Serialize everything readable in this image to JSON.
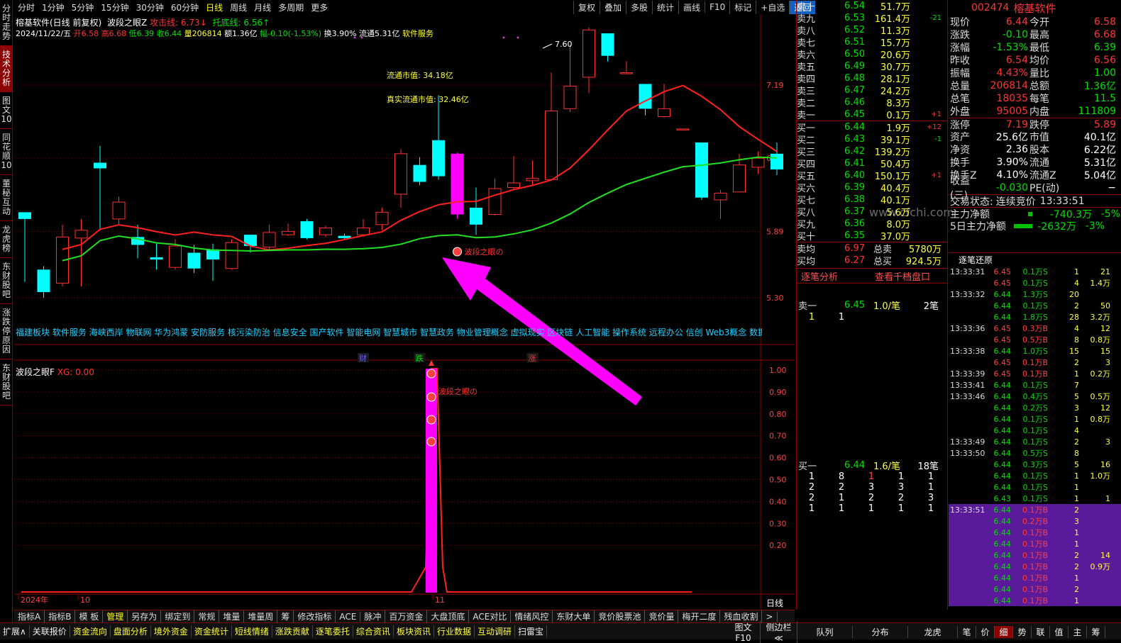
{
  "leftbar": [
    "分时走势",
    "技术分析",
    "图文10",
    "同花顺10",
    "董秘互动",
    "龙虎榜",
    "东财股吧",
    "涨跌停原因",
    "东财股吧"
  ],
  "topbar": {
    "tabs": [
      "分时",
      "1分钟",
      "5分钟",
      "15分钟",
      "30分钟",
      "60分钟",
      "日线",
      "周线",
      "月线",
      "多周期",
      "更多"
    ],
    "active": "日线",
    "right": [
      "复权",
      "叠加",
      "多股",
      "统计",
      "画线",
      "F10",
      "标记",
      "+自选",
      "返回"
    ]
  },
  "title": {
    "name": "榕基软件(日线 前复权)",
    "ind": "波段之眼Z",
    "atk": "攻击线: 6.73↓",
    "sup": "托底线: 6.56↑"
  },
  "ohlc": {
    "date": "2024/11/22/五",
    "open": "开6.58",
    "high": "高6.68",
    "low": "低6.39",
    "close": "收6.44",
    "vol": "量206814",
    "amt": "额1.36亿",
    "chg": "幅-0.10(-1.53%)",
    "turn": "换3.90%",
    "flow": "流通5.31亿",
    "ind": "软件服务"
  },
  "annot": {
    "ltsz": "流通市值: 34.18亿",
    "zsltsz": "真实流通市值: 32.46亿",
    "high": "7.60",
    "signal": "波段之眼の",
    "watermark": "www.cfchi.com"
  },
  "yaxis": [
    "7.19",
    "6.54",
    "5.89",
    "5.30"
  ],
  "yaxis2": [
    "1.00",
    "0.90",
    "0.80",
    "0.70",
    "0.60",
    "0.50",
    "0.40",
    "0.30",
    "0.20"
  ],
  "concepts": "福建板块 软件服务 海峡西岸 物联网 华为鸿蒙 安防服务 核污染防治 信息安全 国产软件 智能电网 智慧城市 智慧政务 物业管理概念 虚拟现实 区块链 人工智能 操作系统 远程办公 信创 Web3概念 数据要素",
  "marks": {
    "cai": "财",
    "die": "跌",
    "zhang": "涨"
  },
  "xaxis": {
    "year": "2024年",
    "m10": "10",
    "m11": "11"
  },
  "sub": {
    "name": "波段之眼F",
    "xg": "XG: 0.00",
    "signal": "波段之眼の"
  },
  "period": "日线",
  "bottom1": [
    "指标A",
    "指标B",
    "模 板",
    "管理",
    "另存为",
    "绑定到",
    "常规",
    "堆量",
    "堆量周",
    "筹",
    "修改指标",
    "ACE",
    "脉冲",
    "百万资金",
    "大盘顶底",
    "ACE对比",
    "情绪风控",
    "东财大单",
    "竞价股票池",
    "竞价量",
    "梅开二度",
    "残血收割",
    ">"
  ],
  "bottom2": [
    "扩展∧",
    "关联报价",
    "资金流向",
    "盘面分析",
    "境外资金",
    "资金统计",
    "短线情绪",
    "涨跌贡献",
    "逐笔委托",
    "综合资讯",
    "板块资讯",
    "行业数据",
    "互动调研",
    "扫雷宝"
  ],
  "bottom2r": [
    "图文F10",
    "侧边栏≪",
    "队列",
    "分布",
    "龙虎",
    "笔",
    "价",
    "细",
    "势",
    "联",
    "值",
    "主",
    "筹"
  ],
  "sells": [
    [
      "卖十",
      "6.54",
      "51.7万",
      ""
    ],
    [
      "卖九",
      "6.53",
      "161.4万",
      "-21"
    ],
    [
      "卖八",
      "6.52",
      "11.3万",
      ""
    ],
    [
      "卖七",
      "6.51",
      "15.7万",
      ""
    ],
    [
      "卖六",
      "6.50",
      "20.6万",
      ""
    ],
    [
      "卖五",
      "6.49",
      "30.7万",
      ""
    ],
    [
      "卖四",
      "6.48",
      "28.1万",
      ""
    ],
    [
      "卖三",
      "6.47",
      "24.2万",
      ""
    ],
    [
      "卖二",
      "6.46",
      "8.3万",
      ""
    ],
    [
      "卖一",
      "6.45",
      "0.1万",
      "+1"
    ]
  ],
  "buys": [
    [
      "买一",
      "6.44",
      "1.9万",
      "+12"
    ],
    [
      "买二",
      "6.43",
      "39.1万",
      "-1"
    ],
    [
      "买三",
      "6.42",
      "139.2万",
      ""
    ],
    [
      "买四",
      "6.41",
      "50.4万",
      ""
    ],
    [
      "买五",
      "6.40",
      "150.1万",
      "+1"
    ],
    [
      "买六",
      "6.39",
      "40.4万",
      ""
    ],
    [
      "买七",
      "6.38",
      "40.1万",
      ""
    ],
    [
      "买八",
      "6.37",
      "5.6万",
      ""
    ],
    [
      "买九",
      "6.36",
      "8.0万",
      ""
    ],
    [
      "买十",
      "6.35",
      "37.0万",
      ""
    ]
  ],
  "avg": {
    "sellavg": "卖均",
    "sellavgv": "6.97",
    "totsell": "总卖",
    "totsellv": "5780万",
    "buyavg": "买均",
    "buyavgv": "6.27",
    "totbuy": "总买",
    "totbuyv": "924.5万"
  },
  "analysis": {
    "a": "逐笔分析",
    "b": "查看千档盘口"
  },
  "q1": {
    "label": "卖一",
    "price": "6.45",
    "qty": "1.0/笔",
    "cnt": "2笔",
    "row": [
      "1",
      "1"
    ]
  },
  "q2": {
    "label": "买一",
    "price": "6.44",
    "qty": "1.6/笔",
    "cnt": "18笔",
    "rows": [
      [
        "1",
        "8",
        "1",
        "1",
        "1"
      ],
      [
        "2",
        "2",
        "3",
        "3",
        "1"
      ],
      [
        "2",
        "1",
        "2",
        "2",
        "3"
      ],
      [
        "1",
        "1",
        "1",
        "1",
        "1"
      ]
    ]
  },
  "stock": {
    "code": "002474",
    "name": "榕基软件"
  },
  "info": [
    [
      "现价",
      "6.44",
      "今开",
      "6.58"
    ],
    [
      "涨跌",
      "-0.10",
      "最高",
      "6.68"
    ],
    [
      "涨幅",
      "-1.53%",
      "最低",
      "6.39"
    ],
    [
      "昨收",
      "6.54",
      "均价",
      "6.56"
    ],
    [
      "振幅",
      "4.43%",
      "量比",
      "1.00"
    ],
    [
      "总量",
      "206814",
      "总额",
      "1.36亿"
    ],
    [
      "总笔",
      "18035",
      "每笔",
      "11.5"
    ],
    [
      "外盘",
      "95005",
      "内盘",
      "111809"
    ],
    [
      "涨停",
      "7.19",
      "跌停",
      "5.89"
    ],
    [
      "资产",
      "25.6亿",
      "市值",
      "40.1亿"
    ],
    [
      "净资",
      "2.36",
      "股本",
      "6.22亿"
    ],
    [
      "换手",
      "3.90%",
      "流通",
      "5.31亿"
    ],
    [
      "换手Z",
      "4.10%",
      "流通Z",
      "5.04亿"
    ],
    [
      "收益(三)",
      "-0.030",
      "PE(动)",
      "−"
    ]
  ],
  "trade": {
    "label": "交易状态:",
    "status": "连续竞价",
    "time": "13:33:51"
  },
  "flow": [
    [
      "主力净额",
      "-740.3万",
      "-5%"
    ],
    [
      "5日主力净额",
      "-2632万",
      "-3%"
    ]
  ],
  "ticks_title": "逐笔还原",
  "ticks": [
    [
      "13:33:31",
      "6.45",
      "0.1万S",
      "1",
      "21"
    ],
    [
      "",
      "6.45",
      "0.1万S",
      "4",
      "1.4万"
    ],
    [
      "13:33:32",
      "6.44",
      "1.3万S",
      "20",
      ""
    ],
    [
      "",
      "6.44",
      "0.1万S",
      "2",
      "50"
    ],
    [
      "",
      "6.44",
      "1.8万S",
      "28",
      "3.2万"
    ],
    [
      "13:33:36",
      "6.45",
      "0.3万B",
      "4",
      "12"
    ],
    [
      "",
      "6.45",
      "0.5万B",
      "8",
      "0.8万"
    ],
    [
      "13:33:38",
      "6.44",
      "1.0万S",
      "15",
      "15"
    ],
    [
      "",
      "6.45",
      "0.1万B",
      "2",
      "3"
    ],
    [
      "13:33:39",
      "6.45",
      "0.1万B",
      "1",
      "0.2万"
    ],
    [
      "13:33:41",
      "6.44",
      "0.1万S",
      "7",
      ""
    ],
    [
      "13:33:46",
      "6.44",
      "0.4万S",
      "5",
      "0.5万"
    ],
    [
      "",
      "6.44",
      "0.2万S",
      "3",
      "12"
    ],
    [
      "",
      "6.44",
      "0.1万S",
      "1",
      "0.8万"
    ],
    [
      "",
      "6.44",
      "0.1万S",
      "4",
      ""
    ],
    [
      "13:33:49",
      "6.44",
      "0.1万S",
      "2",
      "3"
    ],
    [
      "13:33:50",
      "6.44",
      "0.5万S",
      "8",
      ""
    ],
    [
      "",
      "6.44",
      "0.3万S",
      "5",
      "16"
    ],
    [
      "",
      "6.44",
      "0.1万S",
      "1",
      "1.0万"
    ],
    [
      "",
      "6.44",
      "0.1万S",
      "1",
      ""
    ],
    [
      "",
      "6.43",
      "0.1万S",
      "1",
      "1"
    ],
    [
      "13:33:51",
      "6.44",
      "0.1万B",
      "2",
      ""
    ],
    [
      "",
      "6.44",
      "0.2万B",
      "3",
      ""
    ],
    [
      "",
      "6.44",
      "0.1万B",
      "1",
      ""
    ],
    [
      "",
      "6.44",
      "0.1万B",
      "1",
      ""
    ],
    [
      "",
      "6.44",
      "0.1万B",
      "2",
      "14"
    ],
    [
      "",
      "6.44",
      "0.1万B",
      "2",
      "0.9万"
    ],
    [
      "",
      "6.44",
      "0.1万B",
      "1",
      ""
    ],
    [
      "",
      "6.44",
      "0.1万B",
      "2",
      ""
    ],
    [
      "",
      "6.44",
      "0.1万B",
      "1",
      ""
    ]
  ],
  "chart_data": {
    "type": "candlestick",
    "title": "榕基软件(日线 前复权)",
    "series": [
      {
        "name": "K",
        "candles": [
          [
            6.06,
            6.0,
            6.06,
            5.44
          ],
          [
            5.55,
            5.35,
            5.58,
            5.3
          ],
          [
            5.43,
            5.84,
            5.95,
            5.4
          ],
          [
            5.83,
            5.9,
            6.0,
            5.4
          ],
          [
            6.5,
            6.45,
            6.65,
            5.9
          ],
          [
            6.0,
            6.15,
            6.2,
            5.95
          ],
          [
            5.84,
            5.77,
            5.95,
            5.65
          ],
          [
            5.66,
            5.64,
            5.78,
            5.55
          ],
          [
            5.57,
            5.76,
            5.82,
            5.55
          ],
          [
            5.7,
            5.56,
            5.77,
            5.52
          ],
          [
            5.73,
            5.64,
            5.78,
            5.45
          ],
          [
            5.56,
            5.79,
            5.82,
            5.55
          ],
          [
            5.86,
            5.76,
            5.86,
            5.7
          ],
          [
            5.75,
            5.88,
            5.95,
            5.72
          ],
          [
            5.86,
            5.89,
            5.96,
            5.85
          ],
          [
            5.98,
            5.83,
            6.0,
            5.82
          ],
          [
            5.86,
            5.92,
            5.94,
            5.84
          ],
          [
            5.85,
            5.83,
            5.87,
            5.82
          ],
          [
            5.86,
            5.92,
            6.0,
            5.84
          ],
          [
            5.95,
            6.06,
            6.1,
            5.9
          ],
          [
            6.22,
            6.58,
            6.62,
            6.1
          ],
          [
            6.48,
            6.33,
            6.55,
            6.3
          ],
          [
            6.7,
            6.38,
            7.1,
            6.35
          ],
          [
            6.58,
            6.04,
            6.59,
            6.0
          ],
          [
            6.1,
            5.95,
            6.28,
            5.86
          ],
          [
            6.04,
            6.27,
            6.36,
            6.03
          ],
          [
            6.28,
            6.32,
            6.56,
            6.26
          ],
          [
            6.34,
            6.36,
            6.52,
            6.3
          ],
          [
            6.35,
            6.96,
            7.3,
            6.35
          ],
          [
            6.98,
            7.18,
            7.55,
            6.95
          ],
          [
            7.26,
            7.68,
            7.7,
            7.12
          ],
          [
            7.65,
            7.45,
            7.65,
            7.4
          ],
          [
            7.3,
            7.3,
            7.4,
            7.3
          ],
          [
            7.2,
            6.98,
            7.2,
            6.92
          ],
          [
            6.91,
            6.98,
            7.2,
            6.9
          ],
          [
            6.8,
            6.8,
            6.8,
            6.8
          ],
          [
            6.68,
            6.19,
            6.68,
            6.17
          ],
          [
            6.17,
            6.23,
            6.26,
            6.0
          ],
          [
            6.24,
            6.48,
            6.58,
            6.24
          ],
          [
            6.46,
            6.54,
            6.6,
            6.4
          ],
          [
            6.58,
            6.44,
            6.68,
            6.39
          ]
        ]
      },
      {
        "name": "攻击线",
        "values": [],
        "color": "#ff2020"
      },
      {
        "name": "托底线",
        "values": [],
        "color": "#20ff20"
      }
    ]
  }
}
